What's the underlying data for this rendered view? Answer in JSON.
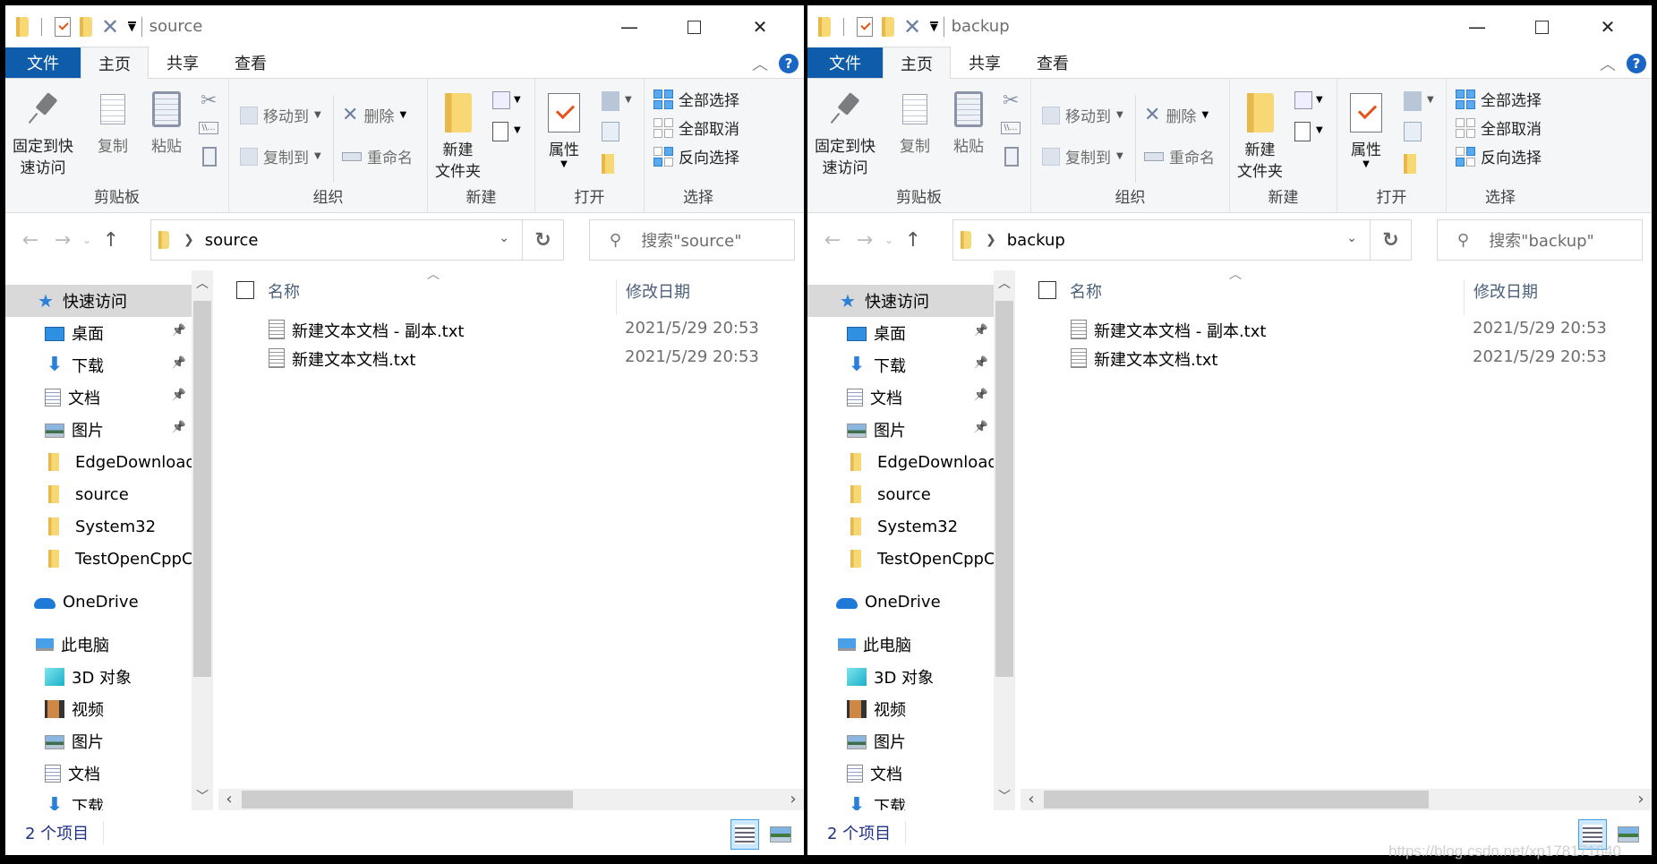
{
  "windows": [
    {
      "title": "source",
      "tabs": {
        "file": "文件",
        "home": "主页",
        "share": "共享",
        "view": "查看"
      },
      "ribbon": {
        "clipboard": {
          "label": "剪贴板",
          "pin": "固定到快\n速访问",
          "pin_line1": "固定到快",
          "pin_line2": "速访问",
          "copy": "复制",
          "paste": "粘贴"
        },
        "organize": {
          "label": "组织",
          "move_to": "移动到",
          "copy_to": "复制到",
          "delete": "删除",
          "rename": "重命名"
        },
        "new": {
          "label": "新建",
          "new_folder_line1": "新建",
          "new_folder_line2": "文件夹"
        },
        "open": {
          "label": "打开",
          "properties": "属性"
        },
        "select": {
          "label": "选择",
          "select_all": "全部选择",
          "select_none": "全部取消",
          "invert": "反向选择"
        }
      },
      "address": {
        "path": "source",
        "search_placeholder": "搜索\"source\""
      },
      "nav": {
        "quick_access": "快速访问",
        "pinned": [
          {
            "label": "桌面",
            "icon": "desktop-icon"
          },
          {
            "label": "下载",
            "icon": "download-icon"
          },
          {
            "label": "文档",
            "icon": "documents-icon"
          },
          {
            "label": "图片",
            "icon": "pictures-icon"
          }
        ],
        "folders": [
          "EdgeDownload",
          "source",
          "System32",
          "TestOpenCppC"
        ],
        "onedrive": "OneDrive",
        "this_pc": "此电脑",
        "pc_items": [
          {
            "label": "3D 对象",
            "icon": "3d-objects-icon"
          },
          {
            "label": "视频",
            "icon": "videos-icon"
          },
          {
            "label": "图片",
            "icon": "pictures-icon"
          },
          {
            "label": "文档",
            "icon": "documents-icon"
          },
          {
            "label": "下载",
            "icon": "download-icon"
          }
        ]
      },
      "columns": {
        "name": "名称",
        "date": "修改日期"
      },
      "files": [
        {
          "name": "新建文本文档 - 副本.txt",
          "date": "2021/5/29 20:53"
        },
        {
          "name": "新建文本文档.txt",
          "date": "2021/5/29 20:53"
        }
      ],
      "status": {
        "count": "2 个项目"
      }
    },
    {
      "title": "backup",
      "tabs": {
        "file": "文件",
        "home": "主页",
        "share": "共享",
        "view": "查看"
      },
      "ribbon": {
        "clipboard": {
          "label": "剪贴板",
          "pin_line1": "固定到快",
          "pin_line2": "速访问",
          "copy": "复制",
          "paste": "粘贴"
        },
        "organize": {
          "label": "组织",
          "move_to": "移动到",
          "copy_to": "复制到",
          "delete": "删除",
          "rename": "重命名"
        },
        "new": {
          "label": "新建",
          "new_folder_line1": "新建",
          "new_folder_line2": "文件夹"
        },
        "open": {
          "label": "打开",
          "properties": "属性"
        },
        "select": {
          "label": "选择",
          "select_all": "全部选择",
          "select_none": "全部取消",
          "invert": "反向选择"
        }
      },
      "address": {
        "path": "backup",
        "search_placeholder": "搜索\"backup\""
      },
      "nav": {
        "quick_access": "快速访问",
        "pinned": [
          {
            "label": "桌面",
            "icon": "desktop-icon"
          },
          {
            "label": "下载",
            "icon": "download-icon"
          },
          {
            "label": "文档",
            "icon": "documents-icon"
          },
          {
            "label": "图片",
            "icon": "pictures-icon"
          }
        ],
        "folders": [
          "EdgeDownload",
          "source",
          "System32",
          "TestOpenCppC"
        ],
        "onedrive": "OneDrive",
        "this_pc": "此电脑",
        "pc_items": [
          {
            "label": "3D 对象",
            "icon": "3d-objects-icon"
          },
          {
            "label": "视频",
            "icon": "videos-icon"
          },
          {
            "label": "图片",
            "icon": "pictures-icon"
          },
          {
            "label": "文档",
            "icon": "documents-icon"
          },
          {
            "label": "下载",
            "icon": "download-icon"
          }
        ]
      },
      "columns": {
        "name": "名称",
        "date": "修改日期"
      },
      "files": [
        {
          "name": "新建文本文档 - 副本.txt",
          "date": "2021/5/29 20:53"
        },
        {
          "name": "新建文本文档.txt",
          "date": "2021/5/29 20:53"
        }
      ],
      "status": {
        "count": "2 个项目"
      }
    }
  ],
  "watermark": "https://blog.csdn.net/xp178171640"
}
